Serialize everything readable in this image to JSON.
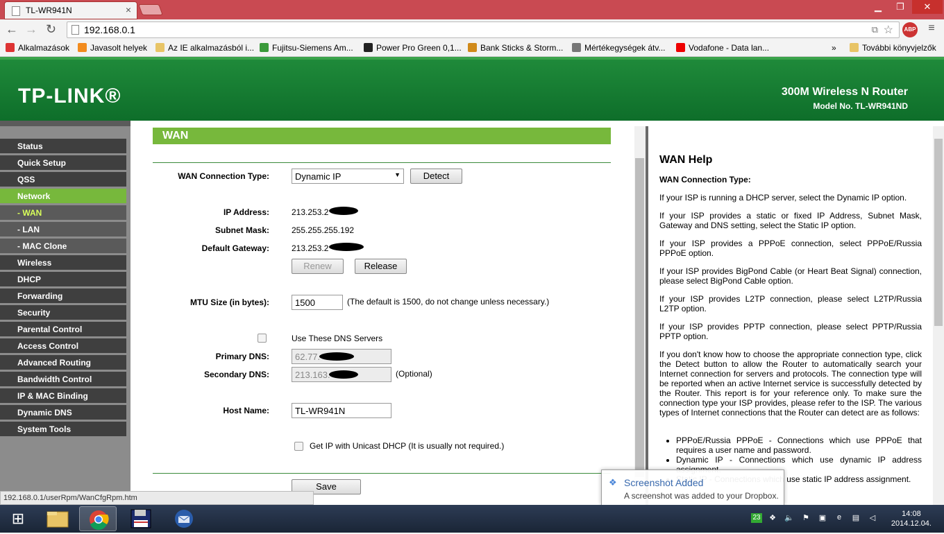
{
  "browser": {
    "tab_title": "TL-WR941N",
    "tab_close": "×",
    "window_min": "▁",
    "window_max": "❐",
    "window_close": "✕",
    "url": "192.168.0.1",
    "abp_label": "ABP",
    "menu_icon": "≡",
    "bookmarks_overflow": "»",
    "bookmarks": [
      {
        "label": "Alkalmazások",
        "color": "#d33"
      },
      {
        "label": "Javasolt helyek",
        "color": "#f28b1e"
      },
      {
        "label": "Az IE alkalmazásból i...",
        "color": "#e8c466"
      },
      {
        "label": "Fujitsu-Siemens Am...",
        "color": "#3a9a3a"
      },
      {
        "label": "Power Pro Green 0,1...",
        "color": "#222"
      },
      {
        "label": "Bank Sticks & Storm...",
        "color": "#d08a1a"
      },
      {
        "label": "Mértékegységek átv...",
        "color": "#777"
      },
      {
        "label": "Vodafone - Data lan...",
        "color": "#e00"
      },
      {
        "label": "További könyvjelzők",
        "color": "#e8c466"
      }
    ],
    "status_url": "192.168.0.1/userRpm/WanCfgRpm.htm"
  },
  "header": {
    "logo": "TP-LINK®",
    "product": "300M Wireless N Router",
    "model": "Model No. TL-WR941ND"
  },
  "menu": [
    {
      "label": "Status",
      "type": "main"
    },
    {
      "label": "Quick Setup",
      "type": "main"
    },
    {
      "label": "QSS",
      "type": "main"
    },
    {
      "label": "Network",
      "type": "active"
    },
    {
      "label": "- WAN",
      "type": "subactive"
    },
    {
      "label": "- LAN",
      "type": "sub"
    },
    {
      "label": "- MAC Clone",
      "type": "sub"
    },
    {
      "label": "Wireless",
      "type": "main"
    },
    {
      "label": "DHCP",
      "type": "main"
    },
    {
      "label": "Forwarding",
      "type": "main"
    },
    {
      "label": "Security",
      "type": "main"
    },
    {
      "label": "Parental Control",
      "type": "main"
    },
    {
      "label": "Access Control",
      "type": "main"
    },
    {
      "label": "Advanced Routing",
      "type": "main"
    },
    {
      "label": "Bandwidth Control",
      "type": "main"
    },
    {
      "label": "IP & MAC Binding",
      "type": "main"
    },
    {
      "label": "Dynamic DNS",
      "type": "main"
    },
    {
      "label": "System Tools",
      "type": "main"
    }
  ],
  "wan": {
    "title": "WAN",
    "conn_type_label": "WAN Connection Type:",
    "conn_type_value": "Dynamic IP",
    "detect_label": "Detect",
    "ip_label": "IP Address:",
    "ip_value": "213.253.2",
    "mask_label": "Subnet Mask:",
    "mask_value": "255.255.255.192",
    "gw_label": "Default Gateway:",
    "gw_value": "213.253.2",
    "renew_label": "Renew",
    "release_label": "Release",
    "mtu_label": "MTU Size (in bytes):",
    "mtu_value": "1500",
    "mtu_note": "(The default is 1500, do not change unless necessary.)",
    "dns_check_label": "Use These DNS Servers",
    "pdns_label": "Primary DNS:",
    "pdns_value": "62.77.",
    "sdns_label": "Secondary DNS:",
    "sdns_value": "213.163.",
    "sdns_note": "(Optional)",
    "host_label": "Host Name:",
    "host_value": "TL-WR941N",
    "unicast_label": "Get IP with Unicast DHCP (It is usually not required.)",
    "save_label": "Save"
  },
  "help": {
    "title": "WAN Help",
    "subtitle": "WAN Connection Type:",
    "p1": "If your ISP is running a DHCP server, select the Dynamic IP option.",
    "p2": "If your ISP provides a static or fixed IP Address, Subnet Mask, Gateway and DNS setting, select the Static IP option.",
    "p3": "If your ISP provides a PPPoE connection, select PPPoE/Russia PPPoE option.",
    "p4": "If your ISP provides BigPond Cable (or Heart Beat Signal) connection, please select BigPond Cable option.",
    "p5": "If your ISP provides L2TP connection, please select L2TP/Russia L2TP option.",
    "p6": "If your ISP provides PPTP connection, please select PPTP/Russia PPTP option.",
    "p7": "If you don't know how to choose the appropriate connection type, click the Detect button to allow the Router to automatically search your Internet connection for servers and protocols. The connection type will be reported when an active Internet service is successfully detected by the Router. This report is for your reference only. To make sure the connection type your ISP provides, please refer to the ISP. The various types of Internet connections that the Router can detect are as follows:",
    "li1": "PPPoE/Russia PPPoE - Connections which use PPPoE that requires a user name and password.",
    "li2": "Dynamic IP - Connections which use dynamic IP address assignment.",
    "li3": "Static IP - Connections which use static IP address assignment."
  },
  "toast": {
    "title": "Screenshot Added",
    "body": "A screenshot was added to your Dropbox."
  },
  "taskbar": {
    "badge": "23",
    "time": "14:08",
    "date": "2014.12.04."
  }
}
